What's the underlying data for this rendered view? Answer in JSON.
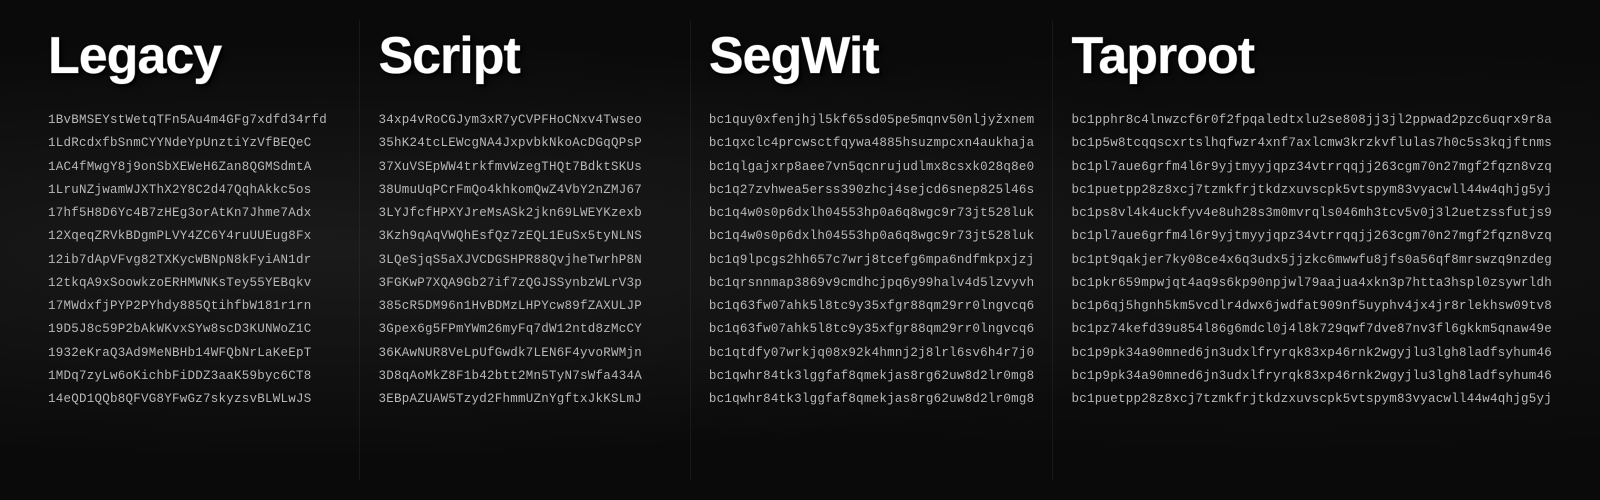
{
  "columns": [
    {
      "id": "legacy",
      "title": "Legacy",
      "addresses": [
        "1BvBMSEYstWetqTFn5Au4m4GFg7xdfd34rfd",
        "1LdRcdxfbSnmCYYNdeYpUnztiYzVfBEQeC",
        "1AC4fMwgY8j9onSbXEWeH6Zan8QGMSdmtA",
        "1LruNZjwamWJXThX2Y8C2d47QqhAkkc5os",
        "17hf5H8D6Yc4B7zHEg3orAtKn7Jhme7Adx",
        "12XqeqZRVkBDgmPLVY4ZC6Y4ruUUEug8Fx",
        "12ib7dApVFvg82TXKycWBNpN8kFyiAN1dr",
        "12tkqA9xSoowkzoERHMWNKsTey55YEBqkv",
        "17MWdxfjPYP2PYhdy885QtihfbW181r1rn",
        "19D5J8c59P2bAkWKvxSYw8scD3KUNWoZ1C",
        "1932eKraQ3Ad9MeNBHb14WFQbNrLaKeEpT",
        "1MDq7zyLw6oKichbFiDDZ3aaK59byc6CT8",
        "14eQD1QQb8QFVG8YFwGz7skyzsvBLWLwJS"
      ]
    },
    {
      "id": "script",
      "title": "Script",
      "addresses": [
        "34xp4vRoCGJym3xR7yCVPFHoCNxv4Twseo",
        "35hK24tcLEWcgNA4JxpvbkNkoAcDGqQPsP",
        "37XuVSEpWW4trkfmvWzegTHQt7BdktSKUs",
        "38UmuUqPCrFmQo4khkomQwZ4VbY2nZMJ67",
        "3LYJfcfHPXYJreMsASk2jkn69LWEYKzexb",
        "3Kzh9qAqVWQhEsfQz7zEQL1EuSx5tyNLNS",
        "3LQeSjqS5aXJVCDGSHPR88QvjheTwrhP8N",
        "3FGKwP7XQA9Gb27if7zQGJSSynbzWLrV3p",
        "385cR5DM96n1HvBDMzLHPYcw89fZAXULJP",
        "3Gpex6g5FPmYWm26myFq7dW12ntd8zMcCY",
        "36KAwNUR8VeLpUfGwdk7LEN6F4yvoRWMjn",
        "3D8qAoMkZ8F1b42btt2Mn5TyN7sWfa434A",
        "3EBpAZUAW5Tzyd2FhmmUZnYgftxJkKSLmJ"
      ]
    },
    {
      "id": "segwit",
      "title": "SegWit",
      "addresses": [
        "bc1quy0xfenjhjl5kf65sd05pe5mqnv50nljyžxnem",
        "bc1qxclc4prcwsctfqywa4885hsuzmpcxn4aukhaja",
        "bc1qlgajxrp8aee7vn5qcnrujudlmx8csxk028q8e0",
        "bc1q27zvhwea5erss390zhcj4sejcd6snep825l46s",
        "bc1q4w0s0p6dxlh04553hp0a6q8wgc9r73jt528luk",
        "bc1q4w0s0p6dxlh04553hp0a6q8wgc9r73jt528luk",
        "bc1q9lpcgs2hh657c7wrj8tcefg6mpa6ndfmkpxjzj",
        "bc1qrsnnmap3869v9cmdhcjpq6y99halv4d5lzvyvh",
        "bc1q63fw07ahk5l8tc9y35xfgr88qm29rr0lngvcq6",
        "bc1q63fw07ahk5l8tc9y35xfgr88qm29rr0lngvcq6",
        "bc1qtdfy07wrkjq08x92k4hmnj2j8lrl6sv6h4r7j0",
        "bc1qwhr84tk3lggfaf8qmekjas8rg62uw8d2lr0mg8",
        "bc1qwhr84tk3lggfaf8qmekjas8rg62uw8d2lr0mg8"
      ]
    },
    {
      "id": "taproot",
      "title": "Taproot",
      "addresses": [
        "bc1pphr8c4lnwzcf6r0f2fpqaledtxlu2se808jj3jl2ppwad2pzc6uqrx9r8a",
        "bc1p5w8tcqqscxrtslhqfwzr4xnf7axlcmw3krzkvflulas7h0c5s3kqjftnms",
        "bc1pl7aue6grfm4l6r9yjtmyyjqpz34vtrrqqjj263cgm70n27mgf2fqzn8vzq",
        "bc1puetpp28z8xcj7tzmkfrjtkdzxuvscpk5vtspym83vyacwll44w4qhjg5yj",
        "bc1ps8vl4k4uckfyv4e8uh28s3m0mvrqls046mh3tcv5v0j3l2uetzssfutjs9",
        "bc1pl7aue6grfm4l6r9yjtmyyjqpz34vtrrqqjj263cgm70n27mgf2fqzn8vzq",
        "bc1pt9qakjer7ky08ce4x6q3udx5jjzkc6mwwfu8jfs0a56qf8mrswzq9nzdeg",
        "bc1pkr659mpwjqt4aq9s6kp90npjwl79aajua4xkn3p7htta3hspl0zsywrldh",
        "bc1p6qj5hgnh5km5vcdlr4dwx6jwdfat909nf5uyphv4jx4jr8rlekhsw09tv8",
        "bc1pz74kefd39u854l86g6mdcl0j4l8k729qwf7dve87nv3fl6gkkm5qnaw49e",
        "bc1p9pk34a90mned6jn3udxlfryrqk83xp46rnk2wgyjlu3lgh8ladfsyhum46",
        "bc1p9pk34a90mned6jn3udxlfryrqk83xp46rnk2wgyjlu3lgh8ladfsyhum46",
        "bc1puetpp28z8xcj7tzmkfrjtkdzxuvscpk5vtspym83vyacwll44w4qhjg5yj"
      ]
    }
  ]
}
